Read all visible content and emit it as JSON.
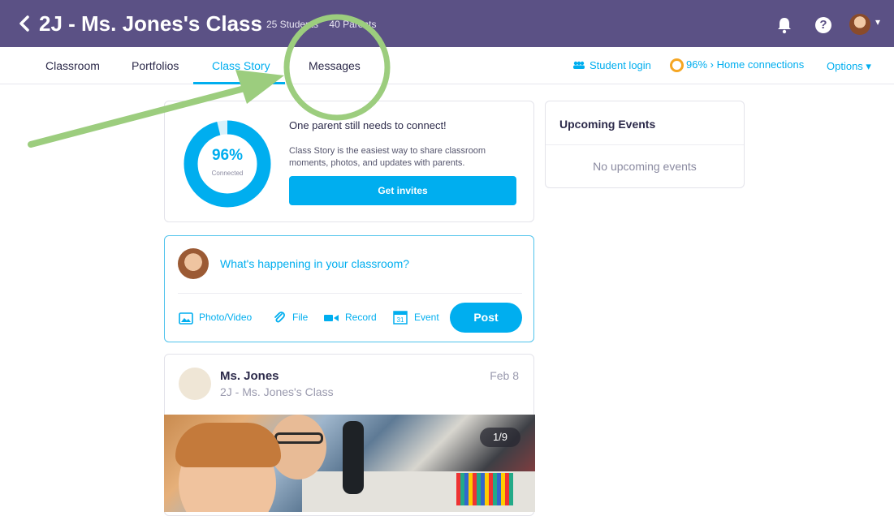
{
  "header": {
    "title": "2J - Ms. Jones's Class",
    "students": "25 Students",
    "parents": "40 Parents",
    "help_label": "?"
  },
  "nav": {
    "tabs": [
      {
        "label": "Classroom"
      },
      {
        "label": "Portfolios"
      },
      {
        "label": "Class Story"
      },
      {
        "label": "Messages"
      }
    ],
    "student_login": "Student login",
    "home_connections": "96% › Home connections",
    "options": "Options ▾"
  },
  "connect_card": {
    "percent": "96%",
    "percent_sub": "Connected",
    "progress": 0.96,
    "title": "One parent still needs to connect!",
    "description": "Class Story is the easiest way to share classroom moments, photos, and updates with parents.",
    "button": "Get invites"
  },
  "compose": {
    "placeholder": "What's happening in your classroom?",
    "actions": {
      "photo": "Photo/Video",
      "file": "File",
      "record": "Record",
      "event": "Event",
      "event_day": "31"
    },
    "post_button": "Post"
  },
  "post": {
    "author": "Ms. Jones",
    "class_name": "2J - Ms. Jones's Class",
    "date": "Feb 8",
    "photo_counter": "1/9"
  },
  "events": {
    "title": "Upcoming Events",
    "empty": "No upcoming events"
  },
  "colors": {
    "header_bg": "#5b5185",
    "accent": "#00aeef",
    "annotation_green": "#9ccd7e",
    "ring_orange": "#f5a623"
  }
}
